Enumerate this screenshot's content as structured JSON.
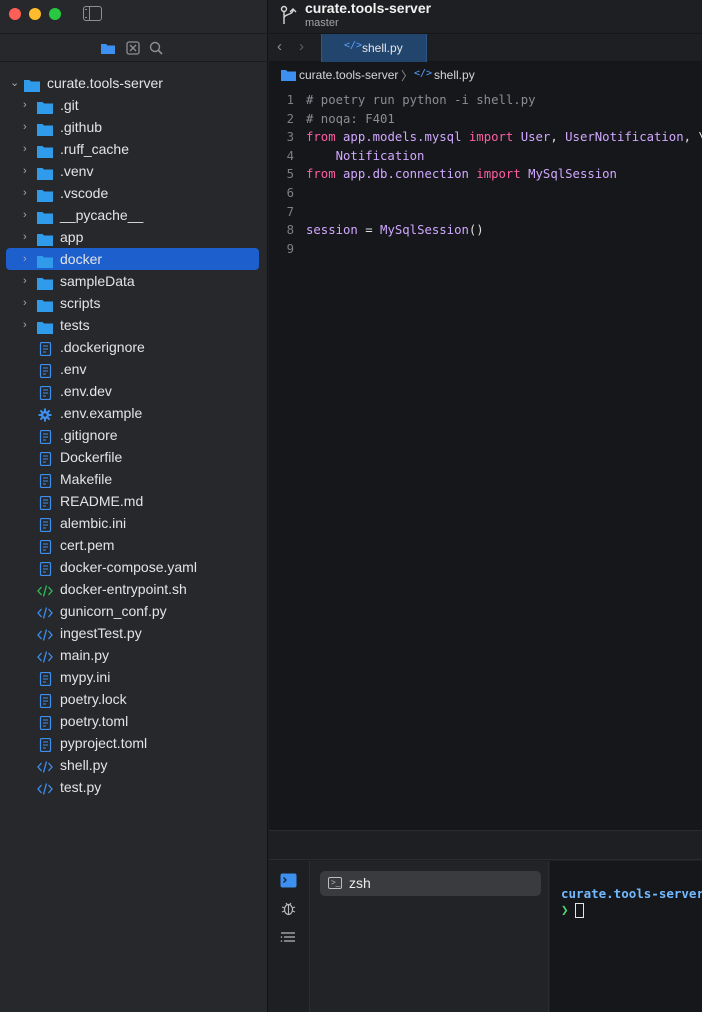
{
  "window": {
    "project_name": "curate.tools-server",
    "branch": "master"
  },
  "sidebar": {
    "root": {
      "label": "curate.tools-server",
      "expanded": true
    },
    "items": [
      {
        "label": ".git",
        "type": "folder"
      },
      {
        "label": ".github",
        "type": "folder"
      },
      {
        "label": ".ruff_cache",
        "type": "folder"
      },
      {
        "label": ".venv",
        "type": "folder"
      },
      {
        "label": ".vscode",
        "type": "folder"
      },
      {
        "label": "__pycache__",
        "type": "folder"
      },
      {
        "label": "app",
        "type": "folder"
      },
      {
        "label": "docker",
        "type": "folder",
        "selected": true
      },
      {
        "label": "sampleData",
        "type": "folder"
      },
      {
        "label": "scripts",
        "type": "folder"
      },
      {
        "label": "tests",
        "type": "folder"
      },
      {
        "label": ".dockerignore",
        "type": "doc"
      },
      {
        "label": ".env",
        "type": "doc"
      },
      {
        "label": ".env.dev",
        "type": "doc"
      },
      {
        "label": ".env.example",
        "type": "gear"
      },
      {
        "label": ".gitignore",
        "type": "doc"
      },
      {
        "label": "Dockerfile",
        "type": "doc"
      },
      {
        "label": "Makefile",
        "type": "doc"
      },
      {
        "label": "README.md",
        "type": "doc"
      },
      {
        "label": "alembic.ini",
        "type": "doc"
      },
      {
        "label": "cert.pem",
        "type": "doc"
      },
      {
        "label": "docker-compose.yaml",
        "type": "doc"
      },
      {
        "label": "docker-entrypoint.sh",
        "type": "code-green"
      },
      {
        "label": "gunicorn_conf.py",
        "type": "code"
      },
      {
        "label": "ingestTest.py",
        "type": "code"
      },
      {
        "label": "main.py",
        "type": "code"
      },
      {
        "label": "mypy.ini",
        "type": "doc"
      },
      {
        "label": "poetry.lock",
        "type": "doc"
      },
      {
        "label": "poetry.toml",
        "type": "doc"
      },
      {
        "label": "pyproject.toml",
        "type": "doc"
      },
      {
        "label": "shell.py",
        "type": "code"
      },
      {
        "label": "test.py",
        "type": "code"
      }
    ]
  },
  "tabs": [
    {
      "label": "shell.py",
      "active": true
    }
  ],
  "breadcrumb": {
    "project": "curate.tools-server",
    "file": "shell.py"
  },
  "code": {
    "lines": [
      {
        "n": "1",
        "tokens": [
          {
            "t": "# poetry run python -i shell.py",
            "c": "cm"
          }
        ]
      },
      {
        "n": "2",
        "tokens": [
          {
            "t": "# noqa: F401",
            "c": "cm"
          }
        ]
      },
      {
        "n": "3",
        "tokens": [
          {
            "t": "from",
            "c": "kw"
          },
          {
            "t": " app.models.mysql ",
            "c": "id"
          },
          {
            "t": "import",
            "c": "kw"
          },
          {
            "t": " User",
            "c": "id"
          },
          {
            "t": ", ",
            "c": "pl"
          },
          {
            "t": "UserNotification",
            "c": "id"
          },
          {
            "t": ", \\",
            "c": "pl"
          }
        ]
      },
      {
        "n": "4",
        "tokens": [
          {
            "t": "    Notification",
            "c": "id"
          }
        ]
      },
      {
        "n": "5",
        "tokens": [
          {
            "t": "from",
            "c": "kw"
          },
          {
            "t": " app.db.connection ",
            "c": "id"
          },
          {
            "t": "import",
            "c": "kw"
          },
          {
            "t": " MySqlSession",
            "c": "id"
          }
        ]
      },
      {
        "n": "6",
        "tokens": []
      },
      {
        "n": "7",
        "tokens": []
      },
      {
        "n": "8",
        "tokens": [
          {
            "t": "session",
            "c": "id"
          },
          {
            "t": " = ",
            "c": "pl"
          },
          {
            "t": "MySqlSession",
            "c": "id"
          },
          {
            "t": "()",
            "c": "pl"
          }
        ]
      },
      {
        "n": "9",
        "tokens": []
      }
    ]
  },
  "terminal": {
    "session_label": "zsh",
    "prompt_path": "curate.tools-server",
    "prompt_symbol": "❯"
  },
  "colors": {
    "accent": "#1d5fcc",
    "folder": "#2f9bea",
    "file_icon": "#3d8ff0",
    "keyword": "#fc5fa3",
    "identifier": "#d0a8ff",
    "comment": "#8b8d93"
  },
  "icons": {
    "bottom_panel": [
      "terminal-icon",
      "bug-icon",
      "list-icon"
    ]
  }
}
